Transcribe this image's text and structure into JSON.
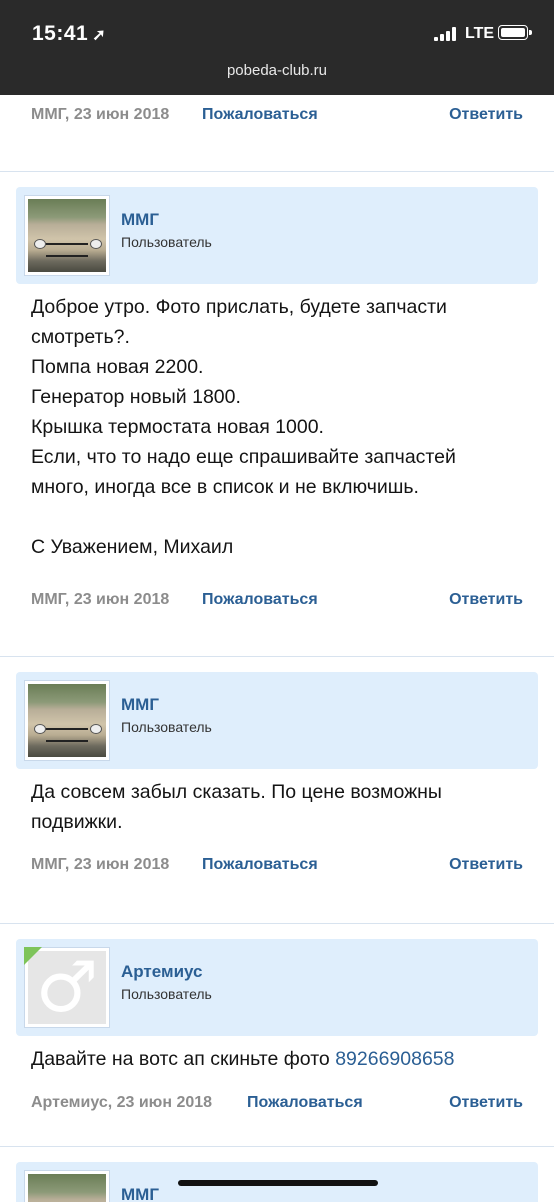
{
  "status_bar": {
    "time": "15:41",
    "network": "LTE",
    "url": "pobeda-club.ru"
  },
  "top_meta": {
    "author_date": "ММГ, 23 июн 2018",
    "report": "Пожаловаться",
    "reply": "Ответить"
  },
  "posts": [
    {
      "username": "ММГ",
      "user_title": "Пользователь",
      "avatar": "car-photo",
      "message": "Доброе утро. Фото прислать, будете запчасти\nсмотреть?.\nПомпа новая 2200.\nГенератор новый 1800.\nКрышка термостата новая 1000.\nЕсли, что то надо еще спрашивайте запчастей\nмного, иногда все в список и не включишь.\n\nС Уважением, Михаил",
      "author_date": "ММГ, 23 июн 2018",
      "report": "Пожаловаться",
      "reply": "Ответить"
    },
    {
      "username": "ММГ",
      "user_title": "Пользователь",
      "avatar": "car-photo",
      "message": "Да совсем забыл сказать. По цене возможны\nподвижки.",
      "author_date": "ММГ, 23 июн 2018",
      "report": "Пожаловаться",
      "reply": "Ответить"
    },
    {
      "username": "Артемиус",
      "user_title": "Пользователь",
      "avatar": "male-icon",
      "message_text": "Давайте на вотс ап скиньте фото ",
      "message_phone": "89266908658",
      "author_date": "Артемиус, 23 июн 2018",
      "report": "Пожаловаться",
      "reply": "Ответить"
    },
    {
      "username": "ММГ"
    }
  ],
  "colors": {
    "status_bar_bg": "#2a2a2a",
    "userbar_bg": "#dfeefc",
    "link": "#2b5f94",
    "meta_gray": "#8c8c8c"
  }
}
